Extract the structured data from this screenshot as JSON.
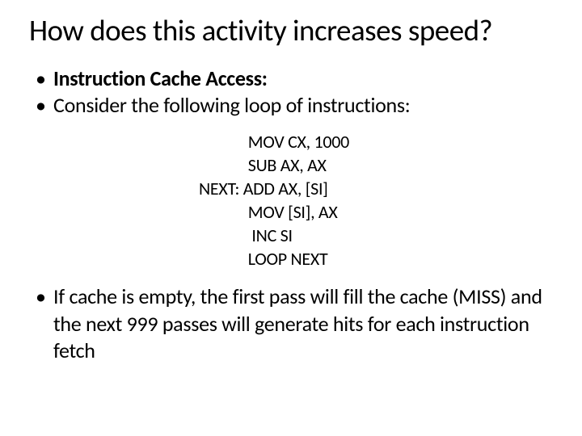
{
  "title": "How does this activity increases speed?",
  "bullets": {
    "b1": "Instruction Cache Access:",
    "b2": "Consider the following loop of instructions:",
    "b3": "If cache is empty, the first pass will fill the cache (MISS) and the next 999 passes will generate hits for each instruction fetch"
  },
  "code": "             MOV CX, 1000\n             SUB AX, AX\nNEXT: ADD AX, [SI]\n             MOV [SI], AX\n              INC SI\n             LOOP NEXT"
}
